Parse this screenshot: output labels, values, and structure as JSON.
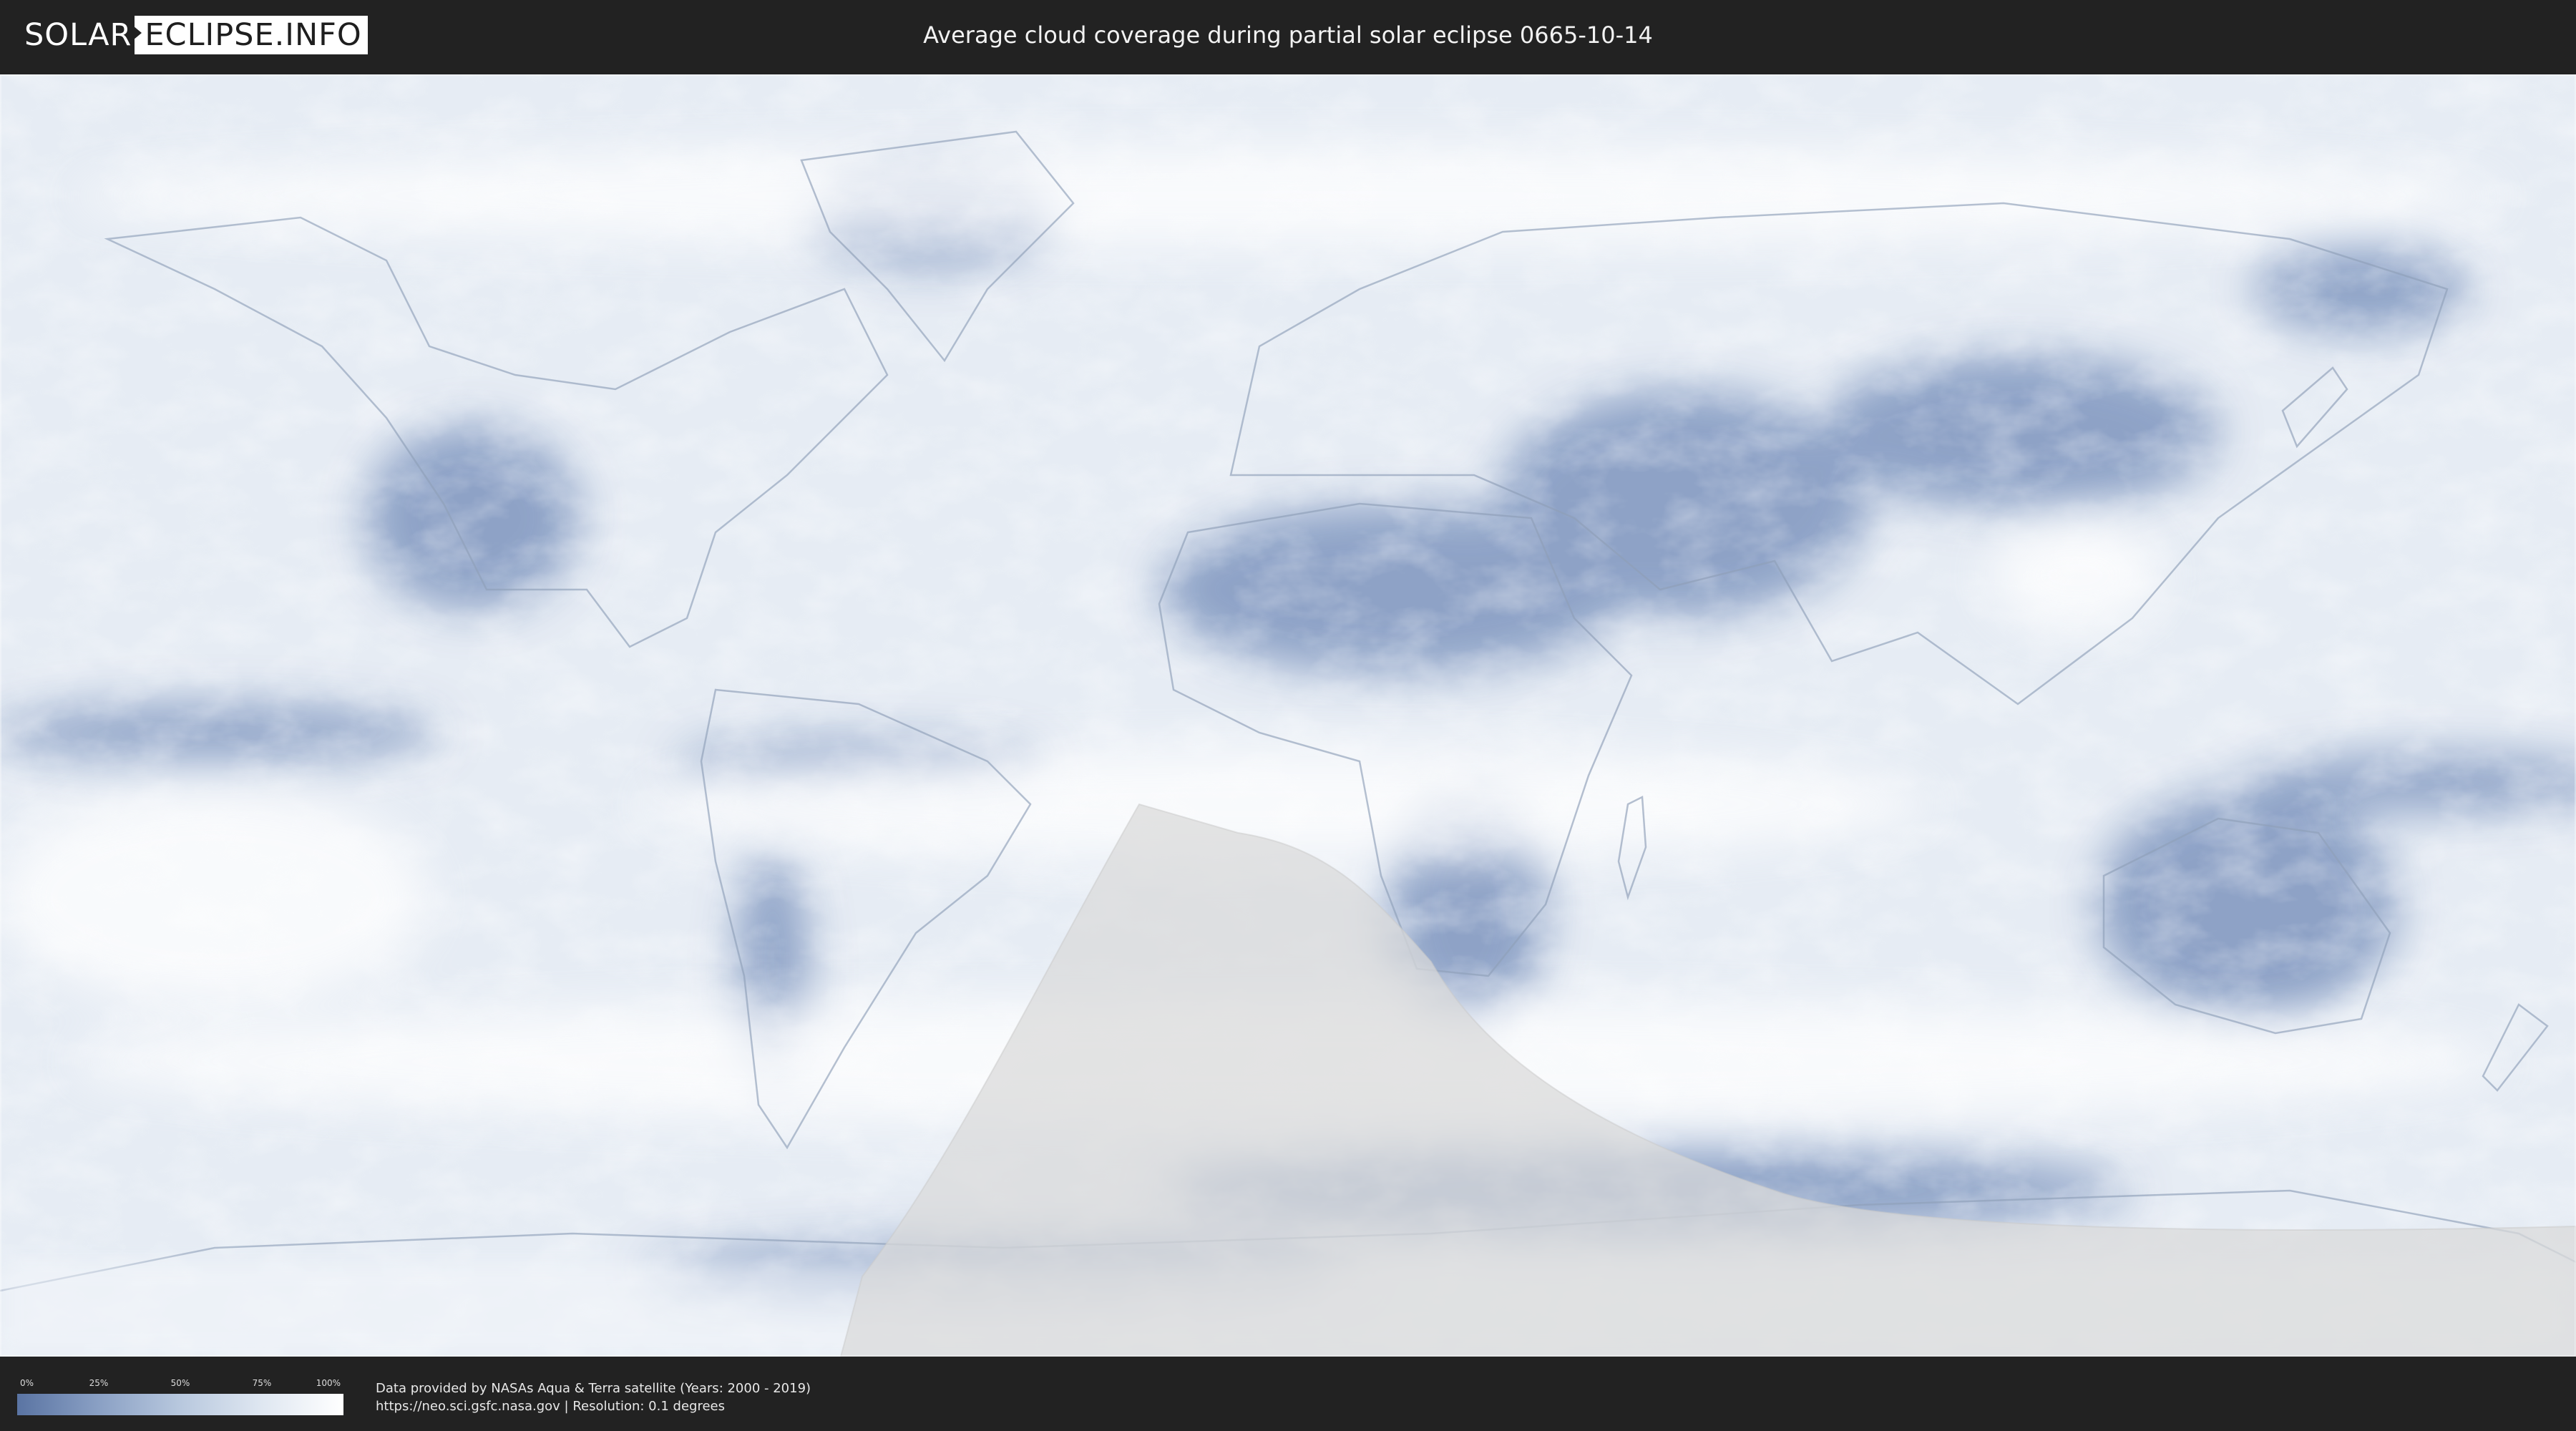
{
  "header": {
    "logo_left": "SOLAR",
    "logo_right": "ECLIPSE.INFO",
    "title": "Average cloud coverage during partial solar eclipse 0665-10-14"
  },
  "colors": {
    "background": "#222222",
    "cloud_clear": "#5a74a3",
    "cloud_full": "#ffffff",
    "eclipse_zone": "#d9d9d9"
  },
  "legend": {
    "ticks": [
      "0%",
      "25%",
      "50%",
      "75%",
      "100%"
    ]
  },
  "credits": {
    "line1": "Data provided by NASAs Aqua & Terra satellite (Years: 2000 - 2019)",
    "line2": "https://neo.sci.gsfc.nasa.gov | Resolution: 0.1 degrees"
  }
}
